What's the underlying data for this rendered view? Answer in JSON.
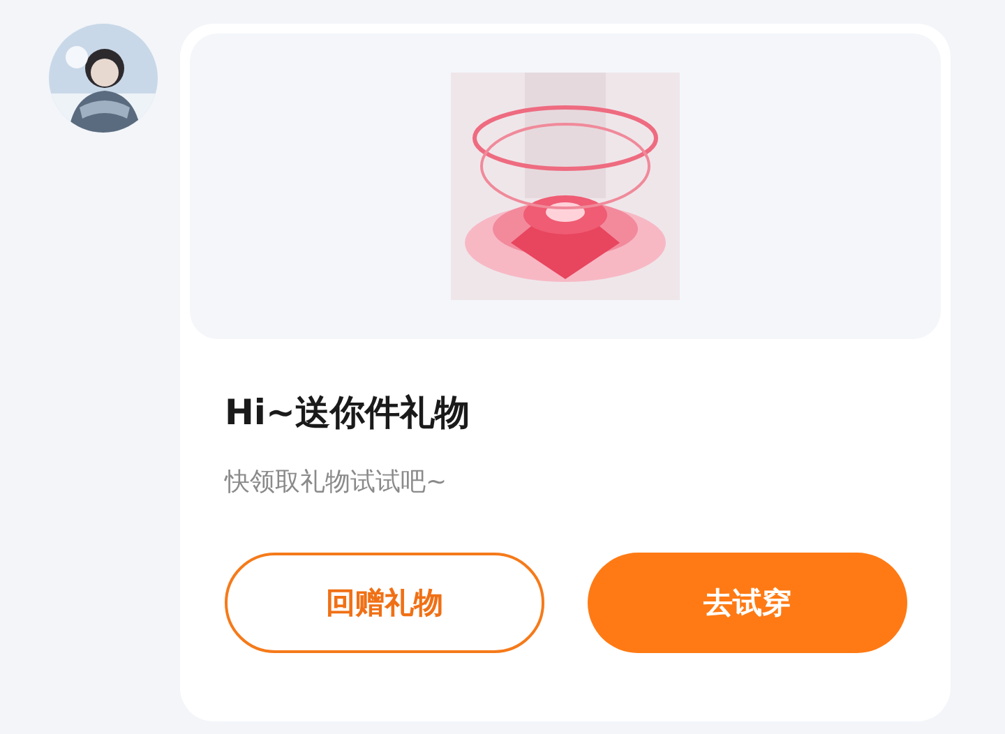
{
  "gift_card": {
    "title": "Hi~送你件礼物",
    "subtitle": "快领取礼物试试吧~",
    "buttons": [
      {
        "label": "回赠礼物",
        "kind": "outline"
      },
      {
        "label": "去试穿",
        "kind": "filled"
      }
    ]
  }
}
